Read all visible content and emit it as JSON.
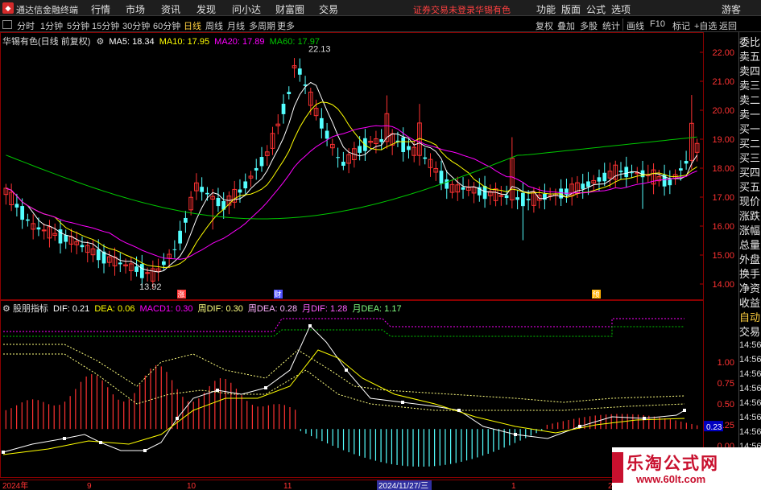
{
  "menubar": {
    "app_name": "通达信金融终端",
    "items": [
      "行情",
      "市场",
      "资讯",
      "发现",
      "问小达",
      "财富圈",
      "交易"
    ],
    "status": "证券交易未登录",
    "stock": "华锡有色",
    "right_items": [
      "功能",
      "版面",
      "公式",
      "选项",
      "游客"
    ]
  },
  "toolbar": {
    "periods": [
      "分时",
      "1分钟",
      "5分钟",
      "15分钟",
      "30分钟",
      "60分钟",
      "日线",
      "周线",
      "月线",
      "多周期",
      "更多"
    ],
    "active_period": "日线",
    "right_buttons": [
      "复权",
      "叠加",
      "多股",
      "统计",
      "画线",
      "F10",
      "标记",
      "+自选",
      "返回"
    ]
  },
  "main_legend": {
    "title": "华锡有色(日线 前复权)",
    "ma5": "MA5: 18.34",
    "ma10": "MA10: 17.95",
    "ma20": "MA20: 17.89",
    "ma60": "MA60: 17.97"
  },
  "price_axis": [
    "22.00",
    "21.00",
    "20.00",
    "19.00",
    "18.00",
    "17.00",
    "16.00",
    "15.00",
    "14.00"
  ],
  "annotations": {
    "high": "22.13",
    "low": "13.92",
    "marker_zhang": "涨",
    "marker_cai": "财",
    "marker_yu": "预"
  },
  "indicator_legend": {
    "name": "股朋指标",
    "dif": "DIF: 0.21",
    "dea": "DEA: 0.06",
    "macd1": "MACD1: 0.30",
    "week_dif": "周DIF: 0.30",
    "week_dea": "周DEA: 0.28",
    "month_dif": "月DIF: 1.28",
    "month_dea": "月DEA: 1.17"
  },
  "indicator_axis": [
    "1.00",
    "0.75",
    "0.50",
    "0.25",
    "0.00"
  ],
  "indicator_current": "0.23",
  "date_axis": [
    "2024年",
    "9",
    "10",
    "11",
    "2024/11/27/三",
    "1",
    "2"
  ],
  "sidebar": [
    "委比",
    "卖五",
    "卖四",
    "卖三",
    "卖二",
    "卖一",
    "买一",
    "买二",
    "买三",
    "买四",
    "买五",
    "现价",
    "涨跌",
    "涨幅",
    "总量",
    "外盘",
    "换手",
    "净资",
    "收益"
  ],
  "sidebar2": [
    "自动",
    "交易"
  ],
  "time_items": [
    "14:56",
    "14:56",
    "14:56",
    "14:56",
    "14:56",
    "14:56",
    "14:56",
    "14:56"
  ],
  "watermark": {
    "line1": "乐淘公式网",
    "line2": "www.60lt.com"
  },
  "colors": {
    "up": "#ff3232",
    "down": "#54ffff",
    "ma5": "#ffffff",
    "ma10": "#ffff00",
    "ma20": "#ff00ff",
    "ma60": "#00c800",
    "grid": "#8b0000"
  }
}
